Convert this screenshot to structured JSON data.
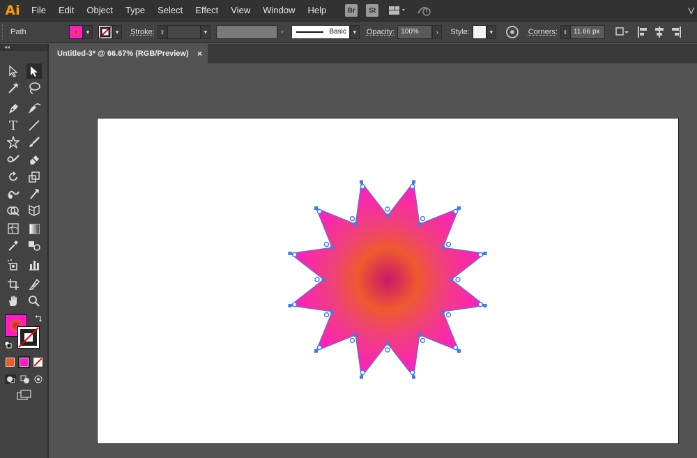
{
  "app": {
    "logo": "Ai",
    "tail": "V"
  },
  "menu": [
    "File",
    "Edit",
    "Object",
    "Type",
    "Select",
    "Effect",
    "View",
    "Window",
    "Help"
  ],
  "bridge": [
    "Br",
    "St"
  ],
  "control": {
    "selection": "Path",
    "stroke_label": "Stroke:",
    "brush_label": "Basic",
    "opacity_label": "Opacity:",
    "opacity_value": "100%",
    "style_label": "Style:",
    "corners_label": "Corners:",
    "corners_value": "11.66 px"
  },
  "document": {
    "tab_title": "Untitled-3* @ 66.67% (RGB/Preview)",
    "close": "×"
  },
  "colors": {
    "gradient_center": "#c8176a",
    "gradient_mid": "#ef5a2e",
    "gradient_outer": "#ff1cc8",
    "anchor": "#3c7cf0",
    "accent": "#ff9a00"
  },
  "icons": [
    "selection-icon",
    "direct-selection-icon",
    "magic-wand-icon",
    "lasso-icon",
    "pen-icon",
    "curvature-icon",
    "type-icon",
    "line-icon",
    "star-icon",
    "paintbrush-icon",
    "shaper-icon",
    "eraser-icon",
    "rotate-icon",
    "scale-icon",
    "warp-icon",
    "free-transform-icon",
    "shape-builder-icon",
    "perspective-icon",
    "mesh-icon",
    "gradient-icon",
    "eyedropper-icon",
    "blend-icon",
    "symbol-sprayer-icon",
    "column-graph-icon",
    "artboard-icon",
    "slice-icon",
    "hand-icon",
    "zoom-icon"
  ]
}
